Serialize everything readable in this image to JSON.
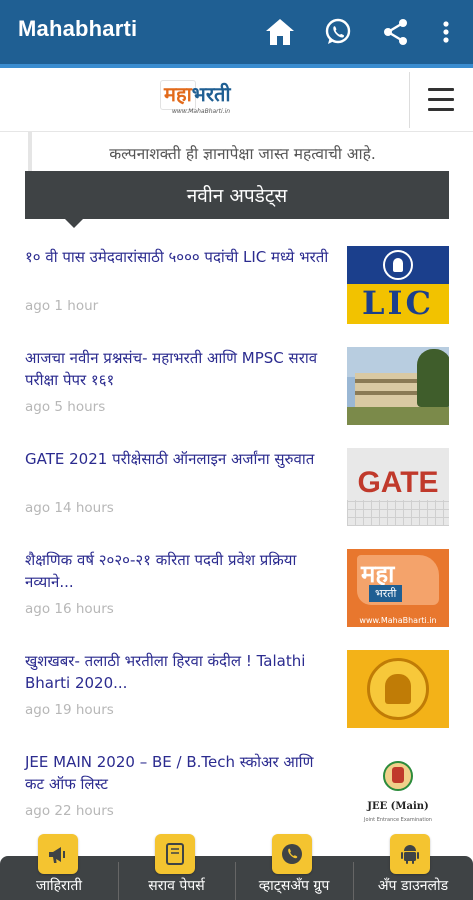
{
  "app_bar": {
    "title": "Mahabharti",
    "icons": [
      "home-icon",
      "whatsapp-icon",
      "share-icon",
      "more-vert-icon"
    ]
  },
  "site_header": {
    "logo": {
      "maha": "महा",
      "bharti": "भरती",
      "url": "www.MahaBharti.in"
    },
    "menu_icon": "hamburger-menu-icon"
  },
  "quote": "कल्पनाशक्ती ही ज्ञानापेक्षा जास्त महत्वाची आहे.",
  "section_title": "नवीन अपडेट्स",
  "articles": [
    {
      "title": "१० वी पास उमेदवारांसाठी ५००० पदांची LIC मध्ये भरती",
      "time": "ago 1 hour",
      "thumb_text": "LIC"
    },
    {
      "title": "आजचा नवीन प्रश्नसंच- महाभरती आणि MPSC सराव परीक्षा पेपर १६१",
      "time": "ago 5 hours"
    },
    {
      "title": "GATE 2021 परीक्षेसाठी ऑनलाइन अर्जांना सुरुवात",
      "time": "ago 14 hours",
      "thumb_text": "GATE"
    },
    {
      "title": "शैक्षणिक वर्ष २०२०-२१ करिता पदवी प्रवेश प्रक्रिया नव्याने...",
      "time": "ago 16 hours",
      "thumb_text": "महा",
      "thumb_sub": "भरती",
      "thumb_url": "www.MahaBharti.in"
    },
    {
      "title": "खुशखबर- तलाठी भरतीला हिरवा कंदील ! Talathi Bharti 2020...",
      "time": "ago 19 hours"
    },
    {
      "title": "JEE MAIN 2020 – BE / B.Tech स्कोअर आणि कट ऑफ लिस्ट",
      "time": "ago 22 hours",
      "thumb_text": "JEE (Main)",
      "thumb_sub": "Joint Entrance Examination"
    }
  ],
  "bottom_nav": [
    {
      "label": "जाहिराती",
      "icon": "megaphone-icon"
    },
    {
      "label": "सराव पेपर्स",
      "icon": "book-icon"
    },
    {
      "label": "व्हाट्सअँप ग्रुप",
      "icon": "phone-icon"
    },
    {
      "label": "अँप डाउनलोड",
      "icon": "android-icon"
    }
  ],
  "colors": {
    "app_bar": "#1f5f93",
    "accent": "#3a8ccf",
    "section_bg": "#3f4345",
    "article_title": "#2b2b8f",
    "nav_icon_bg": "#f4c430"
  }
}
